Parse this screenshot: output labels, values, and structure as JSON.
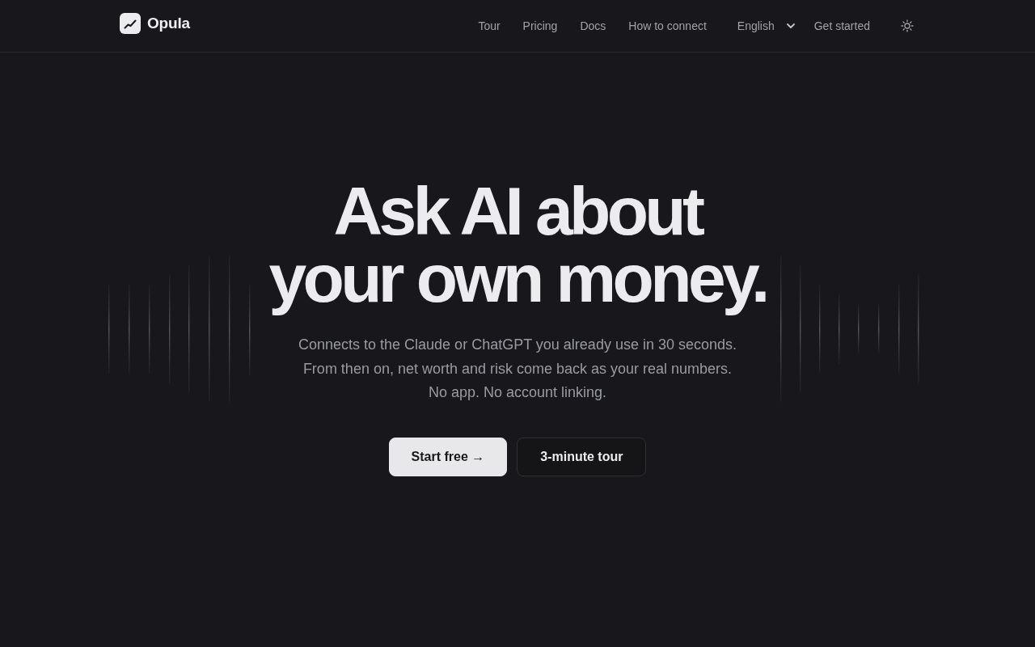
{
  "brand": {
    "name": "Opula"
  },
  "nav": {
    "links": [
      "Tour",
      "Pricing",
      "Docs",
      "How to connect"
    ],
    "language": "English",
    "cta": "Get started"
  },
  "hero": {
    "headline_lines": [
      "Ask AI about",
      "your own money."
    ],
    "subtitle_lines": [
      "Connects to the Claude or ChatGPT you already use in 30 seconds.",
      "From then on, net worth and risk come back as your real numbers.",
      "No app. No account linking."
    ],
    "buttons": [
      {
        "label": "Start free →",
        "kind": "primary"
      },
      {
        "label": "3-minute tour",
        "kind": "secondary"
      }
    ]
  }
}
